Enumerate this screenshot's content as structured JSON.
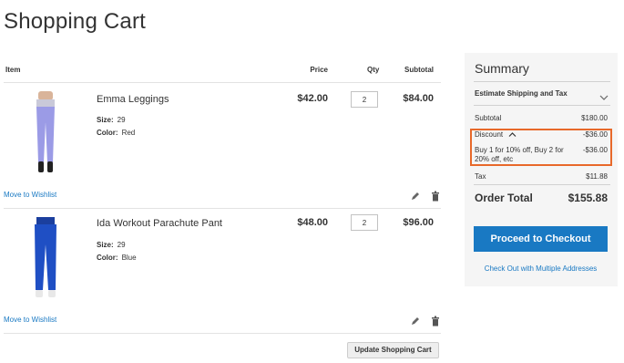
{
  "page": {
    "title": "Shopping Cart"
  },
  "table": {
    "headers": {
      "item": "Item",
      "price": "Price",
      "qty": "Qty",
      "subtotal": "Subtotal"
    }
  },
  "items": [
    {
      "name": "Emma Leggings",
      "size_label": "Size:",
      "size": "29",
      "color_label": "Color:",
      "color": "Red",
      "price": "$42.00",
      "qty": "2",
      "subtotal": "$84.00",
      "wishlist": "Move to Wishlist",
      "image_color": "#9b9be6"
    },
    {
      "name": "Ida Workout Parachute Pant",
      "size_label": "Size:",
      "size": "29",
      "color_label": "Color:",
      "color": "Blue",
      "price": "$48.00",
      "qty": "2",
      "subtotal": "$96.00",
      "wishlist": "Move to Wishlist",
      "image_color": "#1f4fc4"
    }
  ],
  "actions": {
    "update": "Update Shopping Cart"
  },
  "summary": {
    "title": "Summary",
    "estimate_label": "Estimate Shipping and Tax",
    "subtotal_label": "Subtotal",
    "subtotal_value": "$180.00",
    "discount_label": "Discount",
    "discount_value": "-$36.00",
    "rule_label": "Buy 1 for 10% off, Buy 2 for 20% off, etc",
    "rule_value": "-$36.00",
    "tax_label": "Tax",
    "tax_value": "$11.88",
    "order_total_label": "Order Total",
    "order_total_value": "$155.88",
    "checkout_button": "Proceed to Checkout",
    "multi_address_link": "Check Out with Multiple Addresses"
  },
  "colors": {
    "accent": "#1979c3",
    "highlight": "#e8692a",
    "summary_bg": "#f5f5f5"
  }
}
